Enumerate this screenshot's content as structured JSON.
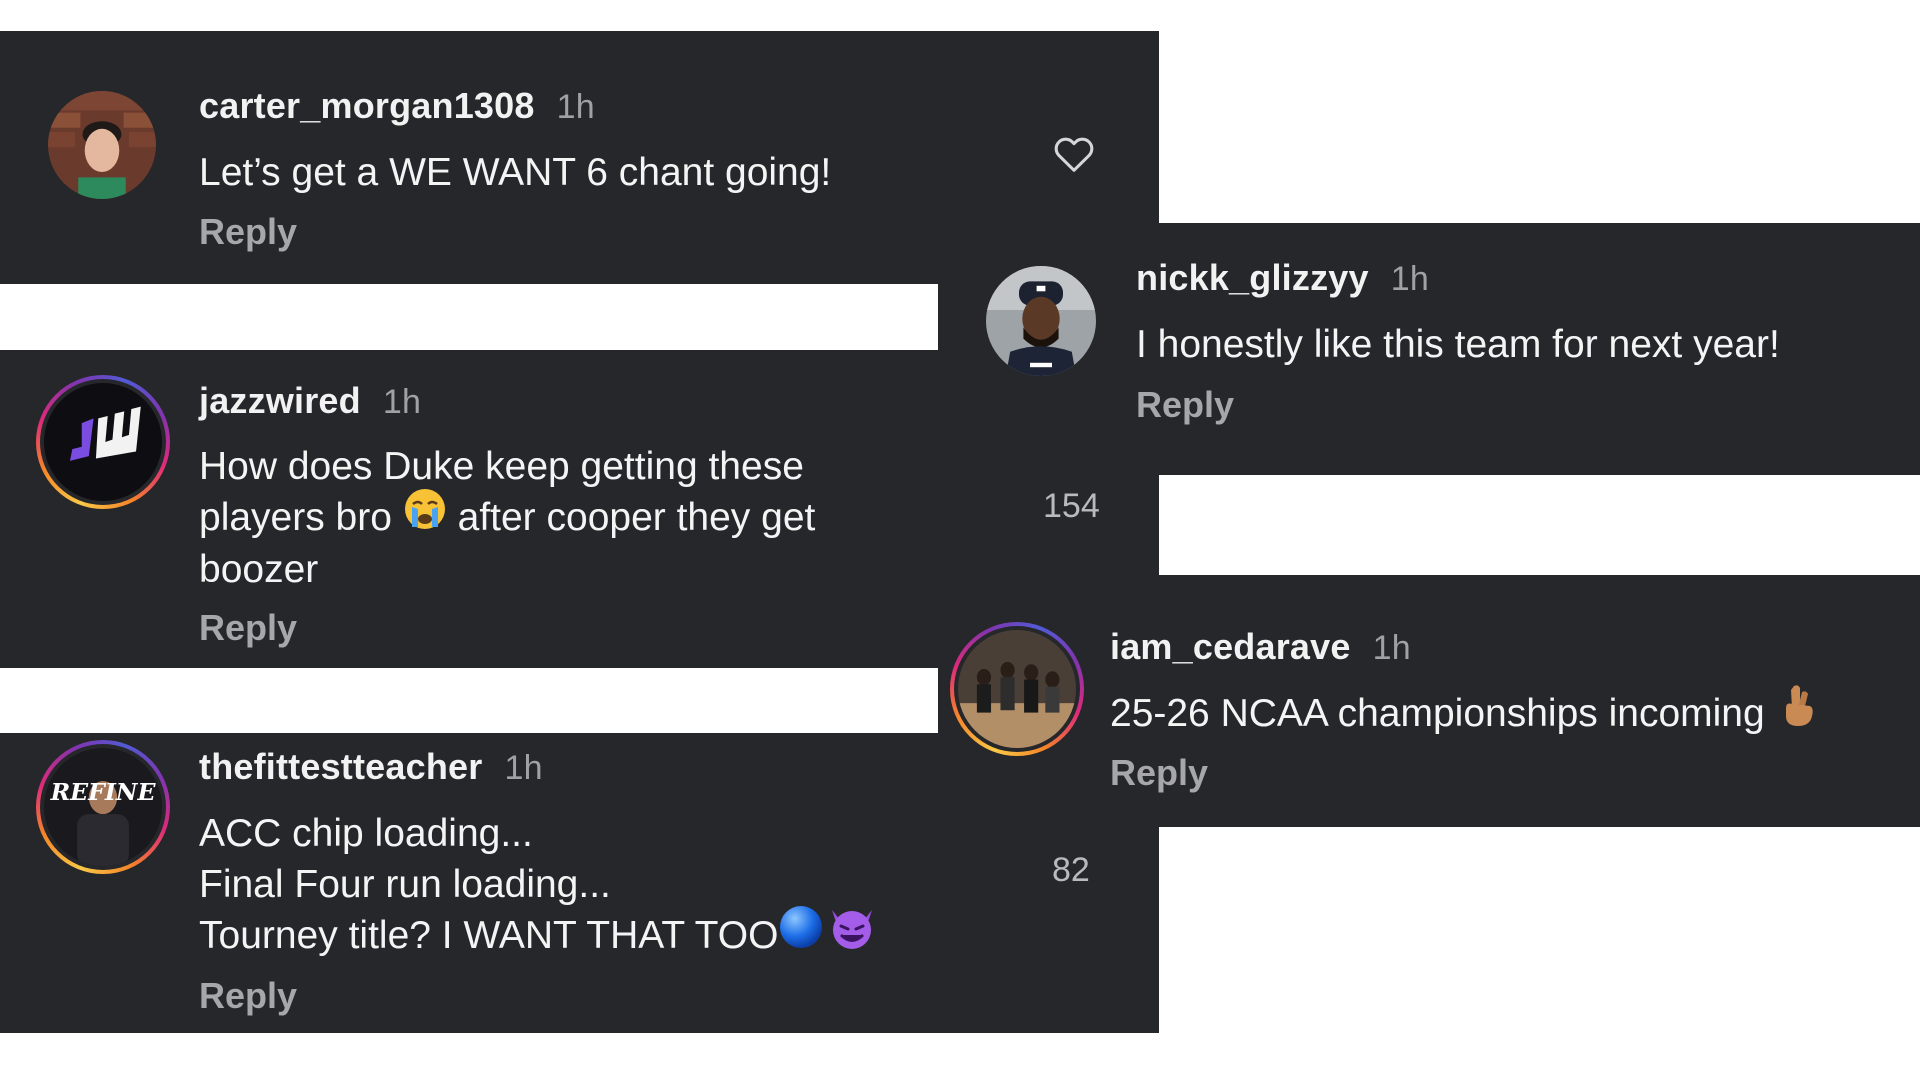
{
  "comments": [
    {
      "username": "carter_morgan1308",
      "time": "1h",
      "text": "Let’s get a WE WANT 6 chant going!",
      "reply": "Reply"
    },
    {
      "username": "jazzwired",
      "time": "1h",
      "lines": [
        "How does Duke keep getting these",
        "after cooper they get",
        "boozer"
      ],
      "line2_prefix": "players bro",
      "reply": "Reply",
      "likes": "154",
      "avatar_text": "JW"
    },
    {
      "username": "thefittestteacher",
      "time": "1h",
      "lines": [
        "ACC chip loading...",
        "Final Four run loading...",
        "Tourney title? I WANT THAT TOO"
      ],
      "reply": "Reply",
      "likes": "82",
      "avatar_text": "REFINE"
    },
    {
      "username": "nickk_glizzyy",
      "time": "1h",
      "text": "I honestly like this team for next year!",
      "reply": "Reply"
    },
    {
      "username": "iam_cedarave",
      "time": "1h",
      "text": "25-26 NCAA championships incoming",
      "reply": "Reply"
    }
  ],
  "icons": {
    "heart": "heart-outline-icon",
    "crying": "loudly-crying-face-emoji",
    "blue_circle": "blue-circle-emoji",
    "devil": "smiling-face-with-horns-emoji",
    "fingers": "crossed-fingers-emoji"
  },
  "colors": {
    "card_bg": "#26272b",
    "page_bg": "#ffffff",
    "username": "#f2f2f2",
    "muted": "#a6a6ab"
  }
}
